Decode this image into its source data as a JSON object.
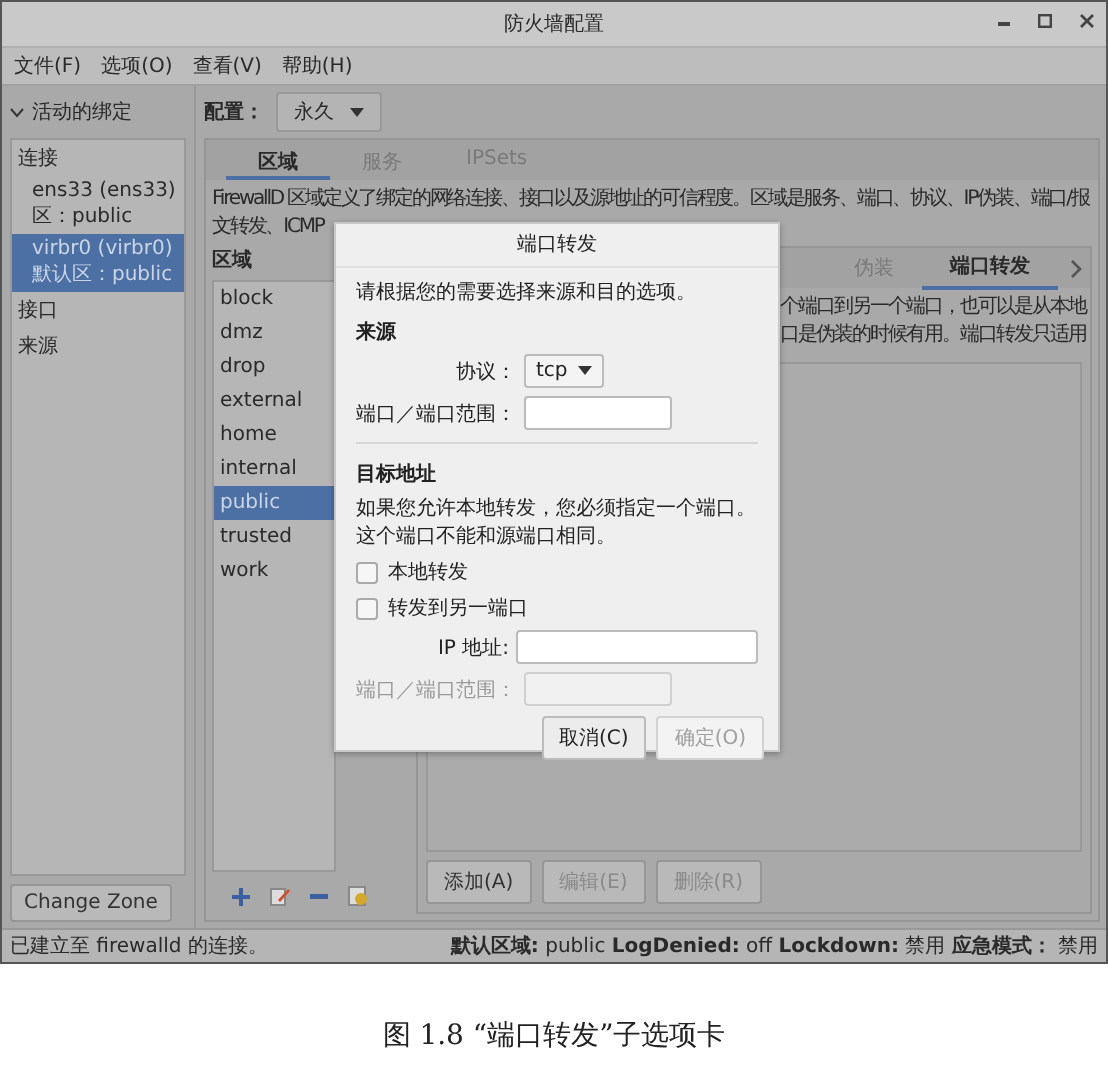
{
  "window": {
    "title": "防火墙配置"
  },
  "menu": [
    "文件(F)",
    "选项(O)",
    "查看(V)",
    "帮助(H)"
  ],
  "bindings": {
    "header": "活动的绑定",
    "expanded": true,
    "items": [
      {
        "kind": "heading",
        "label": "连接"
      },
      {
        "kind": "connection",
        "name": "ens33 (ens33)",
        "zone": "区：public",
        "selected": false
      },
      {
        "kind": "connection",
        "name": "virbr0 (virbr0)",
        "zone": "默认区：public",
        "selected": true
      },
      {
        "kind": "heading",
        "label": "接口"
      },
      {
        "kind": "heading",
        "label": "来源"
      }
    ],
    "button": "Change Zone"
  },
  "config": {
    "label": "配置：",
    "value": "永久"
  },
  "main_tabs": [
    {
      "label": "区域",
      "selected": true
    },
    {
      "label": "服务",
      "selected": false
    },
    {
      "label": "IPSets",
      "selected": false
    }
  ],
  "description": [
    "FirewallD 区域定义了绑定的网络连接、接口以及源地址的可信程度。区域是服务、端口、协议、IP伪装、端口/报",
    "文转发、ICMP"
  ],
  "zones": {
    "label": "区域",
    "items": [
      {
        "name": "block",
        "selected": false
      },
      {
        "name": "dmz",
        "selected": false
      },
      {
        "name": "drop",
        "selected": false
      },
      {
        "name": "external",
        "selected": false
      },
      {
        "name": "home",
        "selected": false
      },
      {
        "name": "internal",
        "selected": false
      },
      {
        "name": "public",
        "selected": true
      },
      {
        "name": "trusted",
        "selected": false
      },
      {
        "name": "work",
        "selected": false
      }
    ]
  },
  "sub_tabs": [
    {
      "label": "伪装",
      "selected": false
    },
    {
      "label": "端口转发",
      "selected": true
    }
  ],
  "port_forward_text": [
    "个端口到另一个端口，也可以是从本地",
    "口是伪装的时候有用。端口转发只适用"
  ],
  "port_buttons": [
    {
      "label": "添加(A)",
      "disabled": false
    },
    {
      "label": "编辑(E)",
      "disabled": true
    },
    {
      "label": "删除(R)",
      "disabled": true
    }
  ],
  "status_bar": {
    "message": "已建立至 firewalld 的连接。",
    "summary": "**默认区域:** public **LogDenied:** off **Lockdown:** 禁用 **应急模式：** 禁用"
  },
  "dialog": {
    "title": "端口转发",
    "prompt": "请根据您的需要选择来源和目的选项。",
    "source": {
      "heading": "来源",
      "protocol_label": "协议：",
      "protocol_value": "tcp",
      "port_label": "端口／端口范围："
    },
    "destination": {
      "heading": "目标地址",
      "note": "如果您允许本地转发，您必须指定一个端口。这个端口不能和源端口相同。",
      "options": [
        {
          "label": "本地转发",
          "checked": false
        },
        {
          "label": "转发到另一端口",
          "checked": false
        }
      ],
      "ip_label": "IP 地址:",
      "port_label": "端口／端口范围：",
      "port_disabled": true
    },
    "buttons": [
      {
        "label": "取消(C)",
        "disabled": false
      },
      {
        "label": "确定(O)",
        "disabled": true
      }
    ]
  },
  "caption": "图 1.8 “端口转发”子选项卡"
}
